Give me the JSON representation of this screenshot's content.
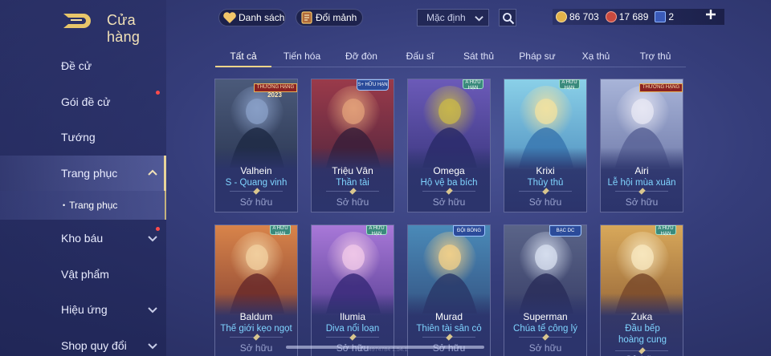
{
  "window": {
    "title": "Cửa hàng"
  },
  "sidebar": {
    "items": [
      {
        "label": "Đề cử",
        "dot": false,
        "chevron": "none"
      },
      {
        "label": "Gói đề cử",
        "dot": true,
        "chevron": "none"
      },
      {
        "label": "Tướng",
        "dot": false,
        "chevron": "none"
      },
      {
        "label": "Trang phục",
        "dot": false,
        "chevron": "up",
        "active": true
      },
      {
        "label": "Kho báu",
        "dot": true,
        "chevron": "down"
      },
      {
        "label": "Vật phẩm",
        "dot": false,
        "chevron": "none"
      },
      {
        "label": "Hiệu ứng",
        "dot": false,
        "chevron": "down"
      },
      {
        "label": "Shop quy đổi",
        "dot": false,
        "chevron": "down"
      }
    ],
    "subitem": {
      "label": "Trang phục",
      "bullet": "•"
    }
  },
  "topbar": {
    "list_button": {
      "label": "Danh sách",
      "icon": "heart-icon"
    },
    "exchange_button": {
      "label": "Đổi mảnh",
      "icon": "fragment-icon"
    },
    "sort_select": {
      "value": "Mặc định"
    },
    "currencies": [
      {
        "icon": "gold-coin-icon",
        "value": "86 703",
        "color": "#e2b24a"
      },
      {
        "icon": "ruby-icon",
        "value": "17 689",
        "color": "#c94a3f"
      },
      {
        "icon": "voucher-icon",
        "value": "2",
        "color": "#8fb6ff"
      }
    ]
  },
  "tabs": [
    "Tất cả",
    "Tiến hóa",
    "Đỡ đòn",
    "Đấu sĩ",
    "Sát thủ",
    "Pháp sư",
    "Xạ thủ",
    "Trợ thủ"
  ],
  "owned_label": "Sở hữu",
  "cards": [
    {
      "hero": "Valhein",
      "skin": "S - Quang vinh",
      "badge": "rank",
      "badge_text": "THƯỜNG HẠNG",
      "badge_year": "2023",
      "colors": [
        "#4b5a7a",
        "#1f2a45",
        "#8aa0c8"
      ]
    },
    {
      "hero": "Triệu Vân",
      "skin": "Thần tài",
      "badge": "label",
      "badge_text": "S+ HỮU HẠN",
      "colors": [
        "#9a3a4a",
        "#3a1f3a",
        "#e2a07a"
      ]
    },
    {
      "hero": "Omega",
      "skin": "Hộ vệ ba bích",
      "badge": "grade",
      "badge_text": "A HỮU HẠN",
      "colors": [
        "#6b5ab8",
        "#2a2a6a",
        "#c9b84a"
      ]
    },
    {
      "hero": "Krixi",
      "skin": "Thủy thủ",
      "badge": "grade",
      "badge_text": "A HỮU HẠN",
      "colors": [
        "#8ad0e8",
        "#3a78b0",
        "#f2e2a0"
      ]
    },
    {
      "hero": "Airi",
      "skin": "Lễ hội mùa xuân",
      "badge": "rank",
      "badge_text": "THƯỜNG HẠNG",
      "colors": [
        "#a8b4d8",
        "#5a6498",
        "#e8e8f4"
      ]
    },
    {
      "hero": "Baldum",
      "skin": "Thế giới kẹo ngọt",
      "badge": "grade",
      "badge_text": "A HỮU HẠN",
      "colors": [
        "#d8844a",
        "#6a2a2a",
        "#f2d0a0"
      ]
    },
    {
      "hero": "Ilumia",
      "skin": "Diva nổi loạn",
      "badge": "grade",
      "badge_text": "A HỮU HẠN",
      "colors": [
        "#a878d8",
        "#3a2a7a",
        "#f0c8e8"
      ]
    },
    {
      "hero": "Murad",
      "skin": "Thiên tài sân cỏ",
      "badge": "label",
      "badge_text": "ĐỘI BÓNG",
      "colors": [
        "#4a8ab8",
        "#2a3a6a",
        "#f2d08a"
      ]
    },
    {
      "hero": "Superman",
      "skin": "Chúa tể công lý",
      "badge": "label",
      "badge_text": "BẠC DC",
      "colors": [
        "#5a6488",
        "#2a2e5a",
        "#d8e0f0"
      ]
    },
    {
      "hero": "Zuka",
      "skin": "Đầu bếp hoàng cung",
      "badge": "grade",
      "badge_text": "A HỮU HẠN",
      "colors": [
        "#d8a85a",
        "#7a4a2a",
        "#f8e8c0"
      ]
    }
  ],
  "footer_text": "ID:74974784 1.54.1"
}
